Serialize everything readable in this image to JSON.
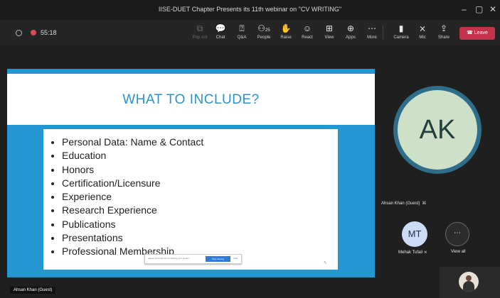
{
  "window": {
    "title": "IISE-DUET Chapter Presents its 11th webinar on \"CV WRITING\""
  },
  "call": {
    "timer": "55:18"
  },
  "toolbar": {
    "pop_out": "Pop out",
    "chat": "Chat",
    "qa": "Q&A",
    "people": "People",
    "people_count": "25",
    "raise": "Raise",
    "react": "React",
    "view": "View",
    "apps": "Apps",
    "more": "More",
    "camera": "Camera",
    "mic": "Mic",
    "share": "Share",
    "leave": "Leave"
  },
  "slide": {
    "title": "WHAT TO INCLUDE?",
    "bullets": [
      "Personal Data: Name & Contact",
      "Education",
      "Honors",
      "Certification/Licensure",
      "Experience",
      "Research Experience",
      "Publications",
      "Presentations",
      "Professional Membership"
    ]
  },
  "share_bar": {
    "text": "teams.microsoft.com is sharing your screen.",
    "stop": "Stop sharing",
    "hide": "Hide"
  },
  "presenter_tag": "Ahsan Khan (Guest)",
  "participants": {
    "main": {
      "initials": "AK",
      "name": "Ahsan Khan (Guest)"
    },
    "second": {
      "initials": "MT",
      "name": "Mehak Tufail"
    },
    "view_all": "View all"
  },
  "colors": {
    "leave": "#c4314b",
    "slide_accent": "#2696d3",
    "ak_avatar": "#cfe0c8",
    "mt_avatar": "#cddcf5"
  }
}
